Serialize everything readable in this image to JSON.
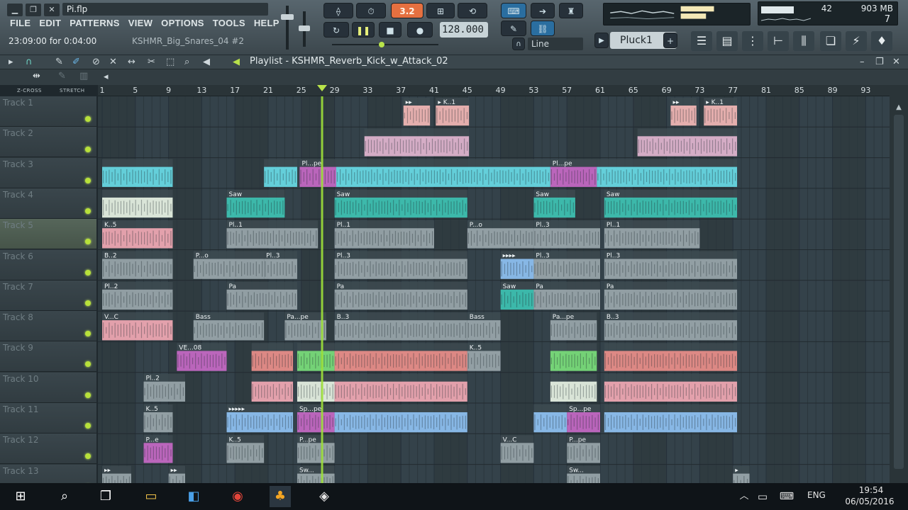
{
  "window": {
    "file_title": "Pi.flp",
    "min_icon": "minimize-icon",
    "restore_icon": "restore-icon",
    "close_icon": "close-icon"
  },
  "menu": [
    "FILE",
    "EDIT",
    "PATTERNS",
    "VIEW",
    "OPTIONS",
    "TOOLS",
    "HELP"
  ],
  "hint": {
    "time": "23:09:00 for 0:04:00",
    "file": "KSHMR_Big_Snares_04 #2"
  },
  "transport": {
    "pat_song": "3.2",
    "tempo": "128.000",
    "snap": "Line"
  },
  "channel": {
    "selected": "Pluck1",
    "add": "+"
  },
  "monitor": {
    "cpu": "42",
    "memory": "903 MB",
    "polyphony": "7"
  },
  "playlist": {
    "title": "Playlist - KSHMR_Reverb_Kick_w_Attack_02",
    "zcross": "Z-CROSS",
    "stretch": "STRETCH",
    "bars": [
      "1",
      "5",
      "9",
      "13",
      "17",
      "21",
      "25",
      "29",
      "33",
      "37",
      "41",
      "45",
      "49",
      "53",
      "57",
      "61",
      "65",
      "69",
      "73",
      "77",
      "81",
      "85",
      "89",
      "93"
    ],
    "tracks": [
      "Track 1",
      "Track 2",
      "Track 3",
      "Track 4",
      "Track 5",
      "Track 6",
      "Track 7",
      "Track 8",
      "Track 9",
      "Track 10",
      "Track 11",
      "Track 12",
      "Track 13"
    ],
    "selected_track": "Track 5",
    "playhead_bar": 27.5,
    "clips": [
      {
        "t": 0,
        "b": 37.3,
        "e": 40.5,
        "c": "#f4b9b6",
        "l": "▸▸"
      },
      {
        "t": 0,
        "b": 41.2,
        "e": 45.2,
        "c": "#f4b9b6",
        "l": "▸ K..1"
      },
      {
        "t": 0,
        "b": 69.5,
        "e": 72.6,
        "c": "#f4b9b6",
        "l": "▸▸"
      },
      {
        "t": 0,
        "b": 73.5,
        "e": 77.5,
        "c": "#f4b9b6",
        "l": "▸ K..1"
      },
      {
        "t": 1,
        "b": 32.6,
        "e": 45.2,
        "c": "#e3b6d0",
        "l": ""
      },
      {
        "t": 1,
        "b": 65.5,
        "e": 77.5,
        "c": "#e3b6d0",
        "l": ""
      },
      {
        "t": 2,
        "b": 1,
        "e": 9.5,
        "c": "#68dbe6",
        "l": ""
      },
      {
        "t": 2,
        "b": 20.5,
        "e": 24.5,
        "c": "#68dbe6",
        "l": ""
      },
      {
        "t": 2,
        "b": 24.8,
        "e": 29.2,
        "c": "#c769c6",
        "l": "Pl...pe"
      },
      {
        "t": 2,
        "b": 29.2,
        "e": 55,
        "c": "#68dbe6",
        "l": ""
      },
      {
        "t": 2,
        "b": 55,
        "e": 60.6,
        "c": "#c769c6",
        "l": "Pl...pe"
      },
      {
        "t": 2,
        "b": 60.6,
        "e": 77.5,
        "c": "#68dbe6",
        "l": ""
      },
      {
        "t": 3,
        "b": 1,
        "e": 9.5,
        "c": "#e8f3e4",
        "l": ""
      },
      {
        "t": 3,
        "b": 16,
        "e": 23,
        "c": "#3ec3b3",
        "l": "Saw"
      },
      {
        "t": 3,
        "b": 29,
        "e": 45,
        "c": "#3ec3b3",
        "l": "Saw"
      },
      {
        "t": 3,
        "b": 53,
        "e": 58,
        "c": "#3ec3b3",
        "l": "Saw"
      },
      {
        "t": 3,
        "b": 61.5,
        "e": 77.5,
        "c": "#3ec3b3",
        "l": "Saw"
      },
      {
        "t": 4,
        "b": 1,
        "e": 9.5,
        "c": "#f2a9b4",
        "l": "K..5"
      },
      {
        "t": 4,
        "b": 16,
        "e": 27,
        "c": "#9aa7ab",
        "l": "Pl..1"
      },
      {
        "t": 4,
        "b": 29,
        "e": 41,
        "c": "#9aa7ab",
        "l": "Pl..1"
      },
      {
        "t": 4,
        "b": 45,
        "e": 53,
        "c": "#9aa7ab",
        "l": "P...o"
      },
      {
        "t": 4,
        "b": 53,
        "e": 61,
        "c": "#9aa7ab",
        "l": "Pl..3"
      },
      {
        "t": 4,
        "b": 61.5,
        "e": 73,
        "c": "#9aa7ab",
        "l": "Pl..1"
      },
      {
        "t": 5,
        "b": 1,
        "e": 9.5,
        "c": "#9aa7ab",
        "l": "B..2"
      },
      {
        "t": 5,
        "b": 12,
        "e": 20.5,
        "c": "#9aa7ab",
        "l": "P...o"
      },
      {
        "t": 5,
        "b": 20.5,
        "e": 24.5,
        "c": "#9aa7ab",
        "l": "Pl..3"
      },
      {
        "t": 5,
        "b": 29,
        "e": 45,
        "c": "#9aa7ab",
        "l": "Pl..3"
      },
      {
        "t": 5,
        "b": 49,
        "e": 53,
        "c": "#8fc2f3",
        "l": "▸▸▸▸"
      },
      {
        "t": 5,
        "b": 53,
        "e": 61,
        "c": "#9aa7ab",
        "l": "Pl..3"
      },
      {
        "t": 5,
        "b": 61.5,
        "e": 77.5,
        "c": "#9aa7ab",
        "l": "Pl..3"
      },
      {
        "t": 6,
        "b": 1,
        "e": 9.5,
        "c": "#9aa7ab",
        "l": "Pl..2"
      },
      {
        "t": 6,
        "b": 16,
        "e": 24.5,
        "c": "#9aa7ab",
        "l": "Pa"
      },
      {
        "t": 6,
        "b": 29,
        "e": 45,
        "c": "#9aa7ab",
        "l": "Pa"
      },
      {
        "t": 6,
        "b": 49,
        "e": 53,
        "c": "#3ec3b3",
        "l": "Saw"
      },
      {
        "t": 6,
        "b": 53,
        "e": 61,
        "c": "#9aa7ab",
        "l": "Pa"
      },
      {
        "t": 6,
        "b": 61.5,
        "e": 77.5,
        "c": "#9aa7ab",
        "l": "Pa"
      },
      {
        "t": 7,
        "b": 1,
        "e": 9.5,
        "c": "#f2a9b4",
        "l": "V...C"
      },
      {
        "t": 7,
        "b": 12,
        "e": 20.5,
        "c": "#9aa7ab",
        "l": "Bass"
      },
      {
        "t": 7,
        "b": 23,
        "e": 28,
        "c": "#9aa7ab",
        "l": "Pa...pe"
      },
      {
        "t": 7,
        "b": 29,
        "e": 45,
        "c": "#9aa7ab",
        "l": "B..3"
      },
      {
        "t": 7,
        "b": 45,
        "e": 49,
        "c": "#9aa7ab",
        "l": "Bass"
      },
      {
        "t": 7,
        "b": 55,
        "e": 60.6,
        "c": "#9aa7ab",
        "l": "Pa...pe"
      },
      {
        "t": 7,
        "b": 61.5,
        "e": 77.5,
        "c": "#9aa7ab",
        "l": "B..3"
      },
      {
        "t": 8,
        "b": 10,
        "e": 16,
        "c": "#c769c6",
        "l": "VE...08"
      },
      {
        "t": 8,
        "b": 19,
        "e": 24,
        "c": "#ec8f8a",
        "l": ""
      },
      {
        "t": 8,
        "b": 24.5,
        "e": 29,
        "c": "#7be07b",
        "l": ""
      },
      {
        "t": 8,
        "b": 29,
        "e": 45,
        "c": "#ec8f8a",
        "l": ""
      },
      {
        "t": 8,
        "b": 45,
        "e": 49,
        "c": "#9aa7ab",
        "l": "K..5"
      },
      {
        "t": 8,
        "b": 55,
        "e": 60.6,
        "c": "#7be07b",
        "l": ""
      },
      {
        "t": 8,
        "b": 61.5,
        "e": 77.5,
        "c": "#ec8f8a",
        "l": ""
      },
      {
        "t": 9,
        "b": 6,
        "e": 11,
        "c": "#9aa7ab",
        "l": "Pl..2"
      },
      {
        "t": 9,
        "b": 19,
        "e": 24,
        "c": "#f2a9b4",
        "l": ""
      },
      {
        "t": 9,
        "b": 24.5,
        "e": 29,
        "c": "#e8f3e4",
        "l": ""
      },
      {
        "t": 9,
        "b": 29,
        "e": 45,
        "c": "#f2a9b4",
        "l": ""
      },
      {
        "t": 9,
        "b": 55,
        "e": 60.6,
        "c": "#e8f3e4",
        "l": ""
      },
      {
        "t": 9,
        "b": 61.5,
        "e": 77.5,
        "c": "#f2a9b4",
        "l": ""
      },
      {
        "t": 10,
        "b": 6,
        "e": 9.5,
        "c": "#9aa7ab",
        "l": "K..5"
      },
      {
        "t": 10,
        "b": 16,
        "e": 24,
        "c": "#8fc2f3",
        "l": "▸▸▸▸▸"
      },
      {
        "t": 10,
        "b": 24.5,
        "e": 29,
        "c": "#c769c6",
        "l": "Sp...pe"
      },
      {
        "t": 10,
        "b": 29,
        "e": 45,
        "c": "#8fc2f3",
        "l": ""
      },
      {
        "t": 10,
        "b": 53,
        "e": 57,
        "c": "#8fc2f3",
        "l": ""
      },
      {
        "t": 10,
        "b": 57,
        "e": 61,
        "c": "#c769c6",
        "l": "Sp...pe"
      },
      {
        "t": 10,
        "b": 61.5,
        "e": 77.5,
        "c": "#8fc2f3",
        "l": ""
      },
      {
        "t": 11,
        "b": 6,
        "e": 9.5,
        "c": "#c769c6",
        "l": "P...e"
      },
      {
        "t": 11,
        "b": 16,
        "e": 20.5,
        "c": "#9aa7ab",
        "l": "K..5"
      },
      {
        "t": 11,
        "b": 24.5,
        "e": 29,
        "c": "#9aa7ab",
        "l": "P...pe"
      },
      {
        "t": 11,
        "b": 49,
        "e": 53,
        "c": "#9aa7ab",
        "l": "V...C"
      },
      {
        "t": 11,
        "b": 57,
        "e": 61,
        "c": "#9aa7ab",
        "l": "P...pe"
      },
      {
        "t": 12,
        "b": 1,
        "e": 4.5,
        "c": "#9aa7ab",
        "l": "▸▸"
      },
      {
        "t": 12,
        "b": 9,
        "e": 11,
        "c": "#9aa7ab",
        "l": "▸▸"
      },
      {
        "t": 12,
        "b": 24.5,
        "e": 29,
        "c": "#9aa7ab",
        "l": "Sw..."
      },
      {
        "t": 12,
        "b": 57,
        "e": 61,
        "c": "#9aa7ab",
        "l": "Sw..."
      },
      {
        "t": 12,
        "b": 77,
        "e": 79,
        "c": "#9aa7ab",
        "l": "▸"
      }
    ]
  },
  "taskbar": {
    "lang": "ENG",
    "time": "19:54",
    "date": "06/05/2016"
  }
}
